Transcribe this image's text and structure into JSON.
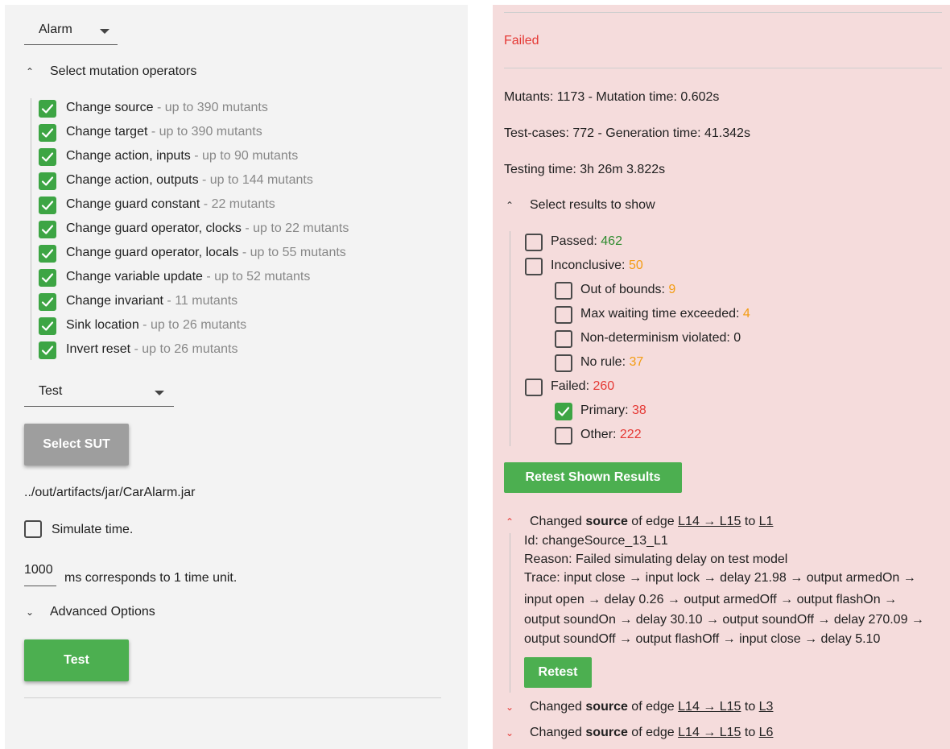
{
  "left": {
    "model_select": "Alarm",
    "operators_header": "Select mutation operators",
    "operators": [
      {
        "name": "Change source",
        "count": " - up to 390 mutants",
        "checked": true
      },
      {
        "name": "Change target",
        "count": " - up to 390 mutants",
        "checked": true
      },
      {
        "name": "Change action, inputs",
        "count": " - up to 90 mutants",
        "checked": true
      },
      {
        "name": "Change action, outputs",
        "count": " - up to 144 mutants",
        "checked": true
      },
      {
        "name": "Change guard constant",
        "count": " - 22 mutants",
        "checked": true
      },
      {
        "name": "Change guard operator, clocks",
        "count": " - up to 22 mutants",
        "checked": true
      },
      {
        "name": "Change guard operator, locals",
        "count": " - up to 55 mutants",
        "checked": true
      },
      {
        "name": "Change variable update",
        "count": " - up to 52 mutants",
        "checked": true
      },
      {
        "name": "Change invariant",
        "count": " - 11 mutants",
        "checked": true
      },
      {
        "name": "Sink location",
        "count": " - up to 26 mutants",
        "checked": true
      },
      {
        "name": "Invert reset",
        "count": " - up to 26 mutants",
        "checked": true
      }
    ],
    "action_select": "Test",
    "select_sut_label": "Select SUT",
    "sut_path": "../out/artifacts/jar/CarAlarm.jar",
    "simulate_time_label": "Simulate time.",
    "time_unit_value": "1000",
    "time_unit_text": "ms corresponds to 1 time unit.",
    "advanced_label": "Advanced Options",
    "test_button": "Test"
  },
  "right": {
    "status": "Failed",
    "mutants_line": "Mutants: 1173 - Mutation time: 0.602s",
    "testcases_line": "Test-cases: 772 - Generation time: 41.342s",
    "testing_time_line": "Testing time: 3h 26m 3.822s",
    "results_header": "Select results to show",
    "results": {
      "passed": {
        "label": "Passed: ",
        "value": "462"
      },
      "inconclusive": {
        "label": "Inconclusive: ",
        "value": "50"
      },
      "out_of_bounds": {
        "label": "Out of bounds: ",
        "value": "9"
      },
      "max_wait": {
        "label": "Max waiting time exceeded: ",
        "value": "4"
      },
      "non_determinism": {
        "label": "Non-determinism violated: 0"
      },
      "no_rule": {
        "label": "No rule: ",
        "value": "37"
      },
      "failed": {
        "label": "Failed: ",
        "value": "260"
      },
      "primary": {
        "label": "Primary: ",
        "value": "38"
      },
      "other": {
        "label": "Other: ",
        "value": "222"
      }
    },
    "retest_shown_label": "Retest Shown Results",
    "mutant_items": [
      {
        "prefix": "Changed ",
        "bold": "source",
        "mid": " of edge ",
        "edge": "L14 → L15",
        "to": " to ",
        "target": "L1"
      },
      {
        "prefix": "Changed ",
        "bold": "source",
        "mid": " of edge ",
        "edge": "L14 → L15",
        "to": " to ",
        "target": "L3"
      },
      {
        "prefix": "Changed ",
        "bold": "source",
        "mid": " of edge ",
        "edge": "L14 → L15",
        "to": " to ",
        "target": "L6"
      }
    ],
    "detail": {
      "id": "Id: changeSource_13_L1",
      "reason": "Reason: Failed simulating delay on test model",
      "trace": [
        "Trace: input close → input lock → delay 21.98 → output armedOn →",
        "input open → delay 0.26 → output armedOff → output flashOn →",
        "output soundOn → delay 30.10 → output soundOff → delay 270.09 →",
        "output soundOff → output flashOff → input close → delay 5.10"
      ],
      "retest_label": "Retest"
    }
  }
}
